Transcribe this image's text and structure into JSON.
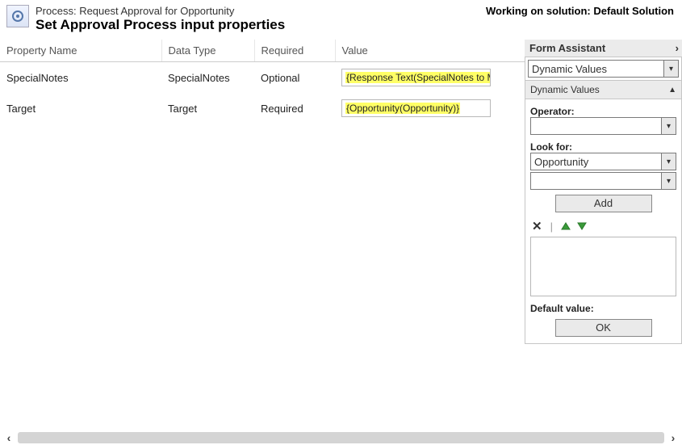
{
  "header": {
    "process_prefix": "Process: ",
    "process_name": "Request Approval for Opportunity",
    "subtitle": "Set Approval Process input properties",
    "working_on": "Working on solution: Default Solution"
  },
  "columns": {
    "property_name": "Property Name",
    "data_type": "Data Type",
    "required": "Required",
    "value": "Value"
  },
  "rows": [
    {
      "property": "SpecialNotes",
      "data_type": "SpecialNotes",
      "required": "Optional",
      "value_token": "{Response Text(SpecialNotes to Manage"
    },
    {
      "property": "Target",
      "data_type": "Target",
      "required": "Required",
      "value_token": "{Opportunity(Opportunity)}"
    }
  ],
  "assistant": {
    "title": "Form Assistant",
    "top_select": "Dynamic Values",
    "section_label": "Dynamic Values",
    "operator_label": "Operator:",
    "operator_value": "",
    "lookfor_label": "Look for:",
    "lookfor_value": "Opportunity",
    "lookfor_value2": "",
    "add_label": "Add",
    "default_label": "Default value:",
    "ok_label": "OK"
  }
}
